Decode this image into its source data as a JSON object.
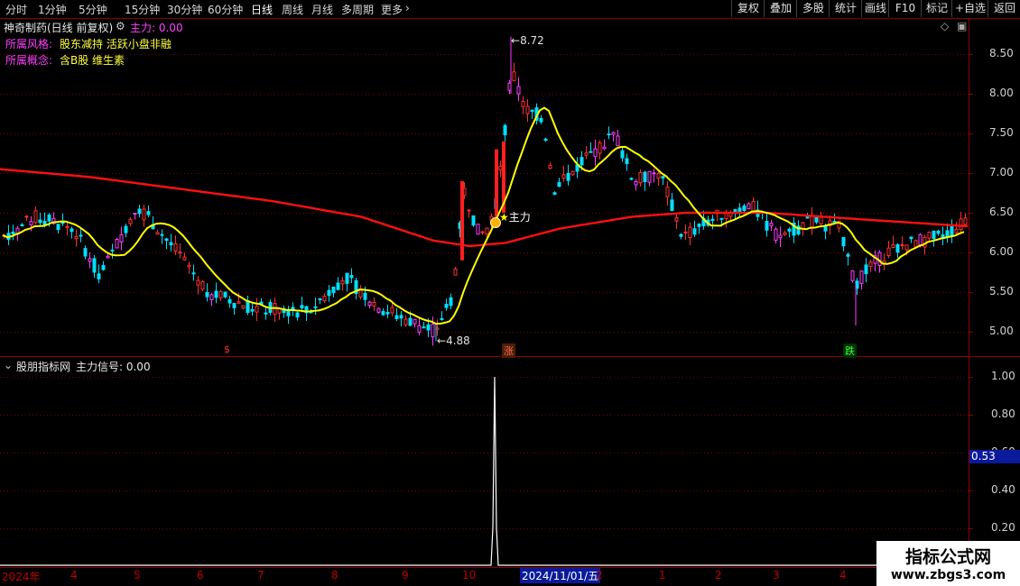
{
  "toolbar": {
    "timeframes": [
      "分时",
      "1分钟",
      "5分钟",
      "15分钟",
      "30分钟",
      "60分钟",
      "日线",
      "周线",
      "月线",
      "多周期",
      "更多"
    ],
    "active": "日线",
    "right_buttons": [
      "复权",
      "叠加",
      "多股",
      "统计",
      "画线",
      "F10",
      "标记",
      "+自选",
      "返回"
    ]
  },
  "main_chart": {
    "title": "神奇制药(日线 前复权)",
    "indicator_label": "主力: 0.00",
    "style_label": "所属风格:",
    "style_value": "股东减持 活跃小盘非融",
    "concept_label": "所属概念:",
    "concept_value": "含B股 维生素",
    "high_label": "8.72",
    "low_label": "4.88",
    "signal_label": "主力",
    "price_axis": [
      "8.50",
      "8.00",
      "7.50",
      "7.00",
      "6.50",
      "6.00",
      "5.50",
      "5.00"
    ],
    "markers": [
      {
        "text": "$",
        "color": "#ff3030"
      },
      {
        "text": "涨",
        "color": "#ff6060"
      },
      {
        "text": "跌",
        "color": "#40ff40"
      }
    ]
  },
  "sub_chart": {
    "title": "股朋指标网",
    "indicator_label": "主力信号: 0.00",
    "axis": [
      "1.00",
      "0.80",
      "0.60",
      "0.40",
      "0.20"
    ],
    "current_value": "0.53"
  },
  "x_axis": {
    "labels": [
      "2024年",
      "4",
      "5",
      "6",
      "7",
      "8",
      "9",
      "10",
      "2",
      "1",
      "2",
      "3",
      "4"
    ],
    "cursor_date": "2024/11/01/五"
  },
  "watermark": {
    "line1": "指标公式网",
    "line2": "www.zbgs3.com"
  },
  "colors": {
    "up": "#ff3030",
    "down": "#00ffff",
    "highlight": "#ff3cff",
    "ma_short": "#ffff00",
    "ma_long": "#ff0000",
    "grid": "#7a0000"
  }
}
